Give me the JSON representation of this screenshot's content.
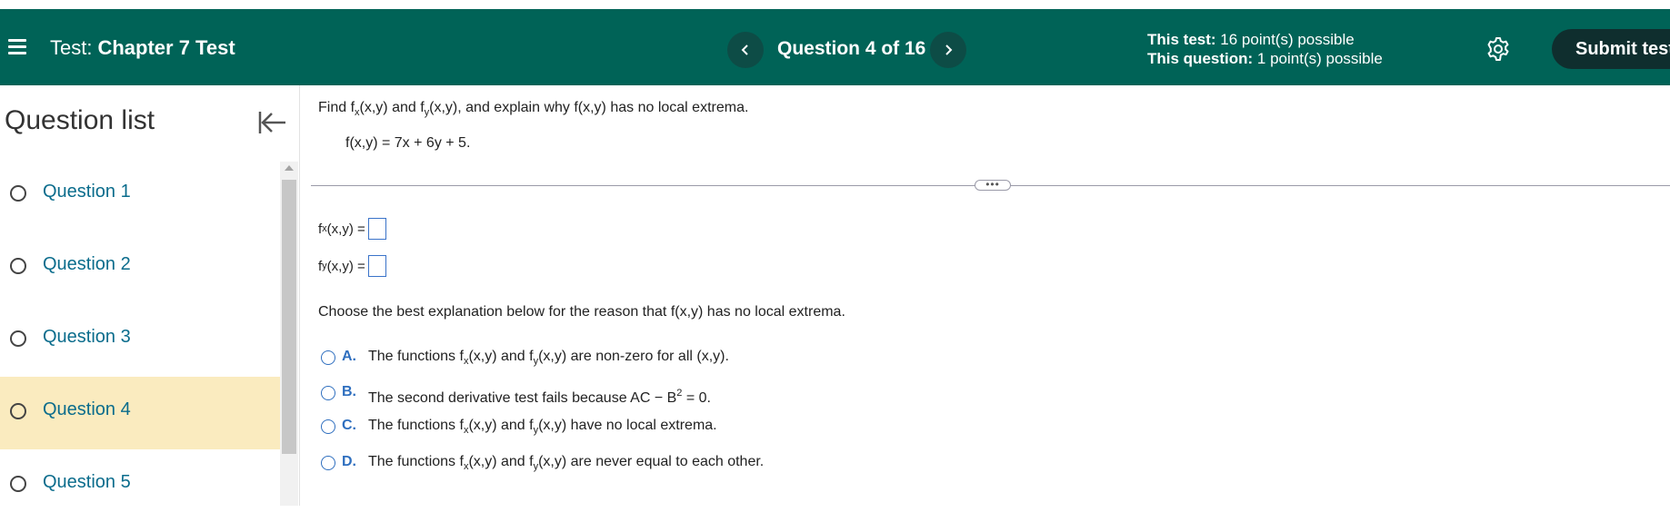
{
  "header": {
    "test_label": "Test:",
    "test_name": "Chapter 7 Test",
    "question_counter": "Question 4 of 16",
    "test_points_label": "This test:",
    "test_points_value": "16 point(s) possible",
    "question_points_label": "This question:",
    "question_points_value": "1 point(s) possible",
    "submit_label": "Submit test",
    "colors": {
      "background": "#006357",
      "nav_button": "#0d4c46",
      "submit_button": "#0f2e2e"
    },
    "icons": [
      "menu-icon",
      "chevron-left-icon",
      "chevron-right-icon",
      "gear-icon"
    ]
  },
  "sidebar": {
    "title": "Question list",
    "collapse_icon": "collapse-left-icon",
    "items": [
      {
        "label": "Question 1",
        "active": false
      },
      {
        "label": "Question 2",
        "active": false
      },
      {
        "label": "Question 3",
        "active": false
      },
      {
        "label": "Question 4",
        "active": true
      },
      {
        "label": "Question 5",
        "active": false
      }
    ],
    "active_color": "#faebbf"
  },
  "question": {
    "prompt": {
      "find": "Find f",
      "sub_x": "x",
      "xy1": "(x,y) and f",
      "sub_y": "y",
      "xy2": "(x,y), and explain why f(x,y) has no local extrema."
    },
    "function": "f(x,y) = 7x + 6y + 5.",
    "divider_handle": "•••",
    "answers": [
      {
        "f": "f",
        "sub": "x",
        "rest": "(x,y) =",
        "value": ""
      },
      {
        "f": "f",
        "sub": "y",
        "rest": "(x,y) =",
        "value": ""
      }
    ],
    "choose_text": "Choose the best explanation below for the reason that f(x,y) has no local extrema.",
    "options": [
      {
        "letter": "A.",
        "t1": "The functions f",
        "s1": "x",
        "t2": "(x,y) and f",
        "s2": "y",
        "t3": "(x,y) are non-zero for all (x,y)."
      },
      {
        "letter": "B.",
        "t1": "The second derivative test fails because AC − B",
        "sup": "2",
        "t2": " = 0."
      },
      {
        "letter": "C.",
        "t1": "The functions f",
        "s1": "x",
        "t2": "(x,y) and f",
        "s2": "y",
        "t3": "(x,y) have no local extrema."
      },
      {
        "letter": "D.",
        "t1": "The functions f",
        "s1": "x",
        "t2": "(x,y) and f",
        "s2": "y",
        "t3": "(x,y) are never equal to each other."
      }
    ]
  }
}
